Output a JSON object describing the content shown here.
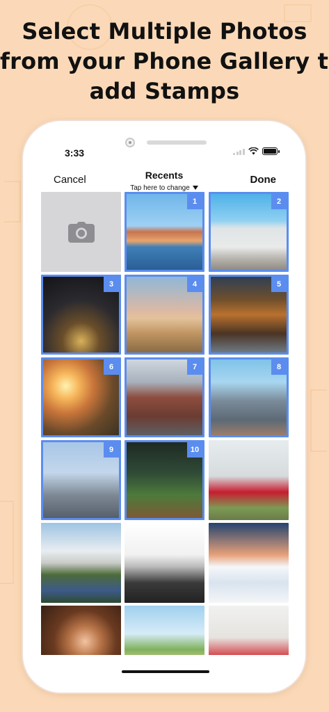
{
  "headline": {
    "line1": "Select Multiple Photos",
    "line2": "from your Phone Gallery to",
    "line3": "add Stamps"
  },
  "status_bar": {
    "time": "3:33",
    "icons": [
      "signal-icon",
      "wifi-icon",
      "battery-icon"
    ]
  },
  "picker": {
    "cancel_label": "Cancel",
    "title": "Recents",
    "subtitle": "Tap here to change",
    "done_label": "Done"
  },
  "colors": {
    "background": "#fbd9b8",
    "selection": "#5b8def",
    "camera_tile": "#d6d6d8"
  },
  "photos": [
    {
      "subject": "camera",
      "selected": false,
      "badge": ""
    },
    {
      "subject": "harbor-town",
      "selected": true,
      "badge": "1"
    },
    {
      "subject": "buddha-statue",
      "selected": true,
      "badge": "2"
    },
    {
      "subject": "cathedral-interior",
      "selected": true,
      "badge": "3"
    },
    {
      "subject": "hot-air-balloons",
      "selected": true,
      "badge": "4"
    },
    {
      "subject": "market-street",
      "selected": true,
      "badge": "5"
    },
    {
      "subject": "sunset-field",
      "selected": true,
      "badge": "6"
    },
    {
      "subject": "city-street",
      "selected": true,
      "badge": "7"
    },
    {
      "subject": "twin-towers",
      "selected": true,
      "badge": "8"
    },
    {
      "subject": "skyscraper",
      "selected": true,
      "badge": "9"
    },
    {
      "subject": "deer-forest",
      "selected": true,
      "badge": "10"
    },
    {
      "subject": "taj-mahal",
      "selected": false,
      "badge": ""
    },
    {
      "subject": "temple-garden",
      "selected": false,
      "badge": ""
    },
    {
      "subject": "road-jump",
      "selected": false,
      "badge": ""
    },
    {
      "subject": "cloud-couple",
      "selected": false,
      "badge": ""
    },
    {
      "subject": "portrait-woman",
      "selected": false,
      "badge": ""
    },
    {
      "subject": "hat-woman",
      "selected": false,
      "badge": ""
    },
    {
      "subject": "heart-balloons",
      "selected": false,
      "badge": ""
    }
  ]
}
